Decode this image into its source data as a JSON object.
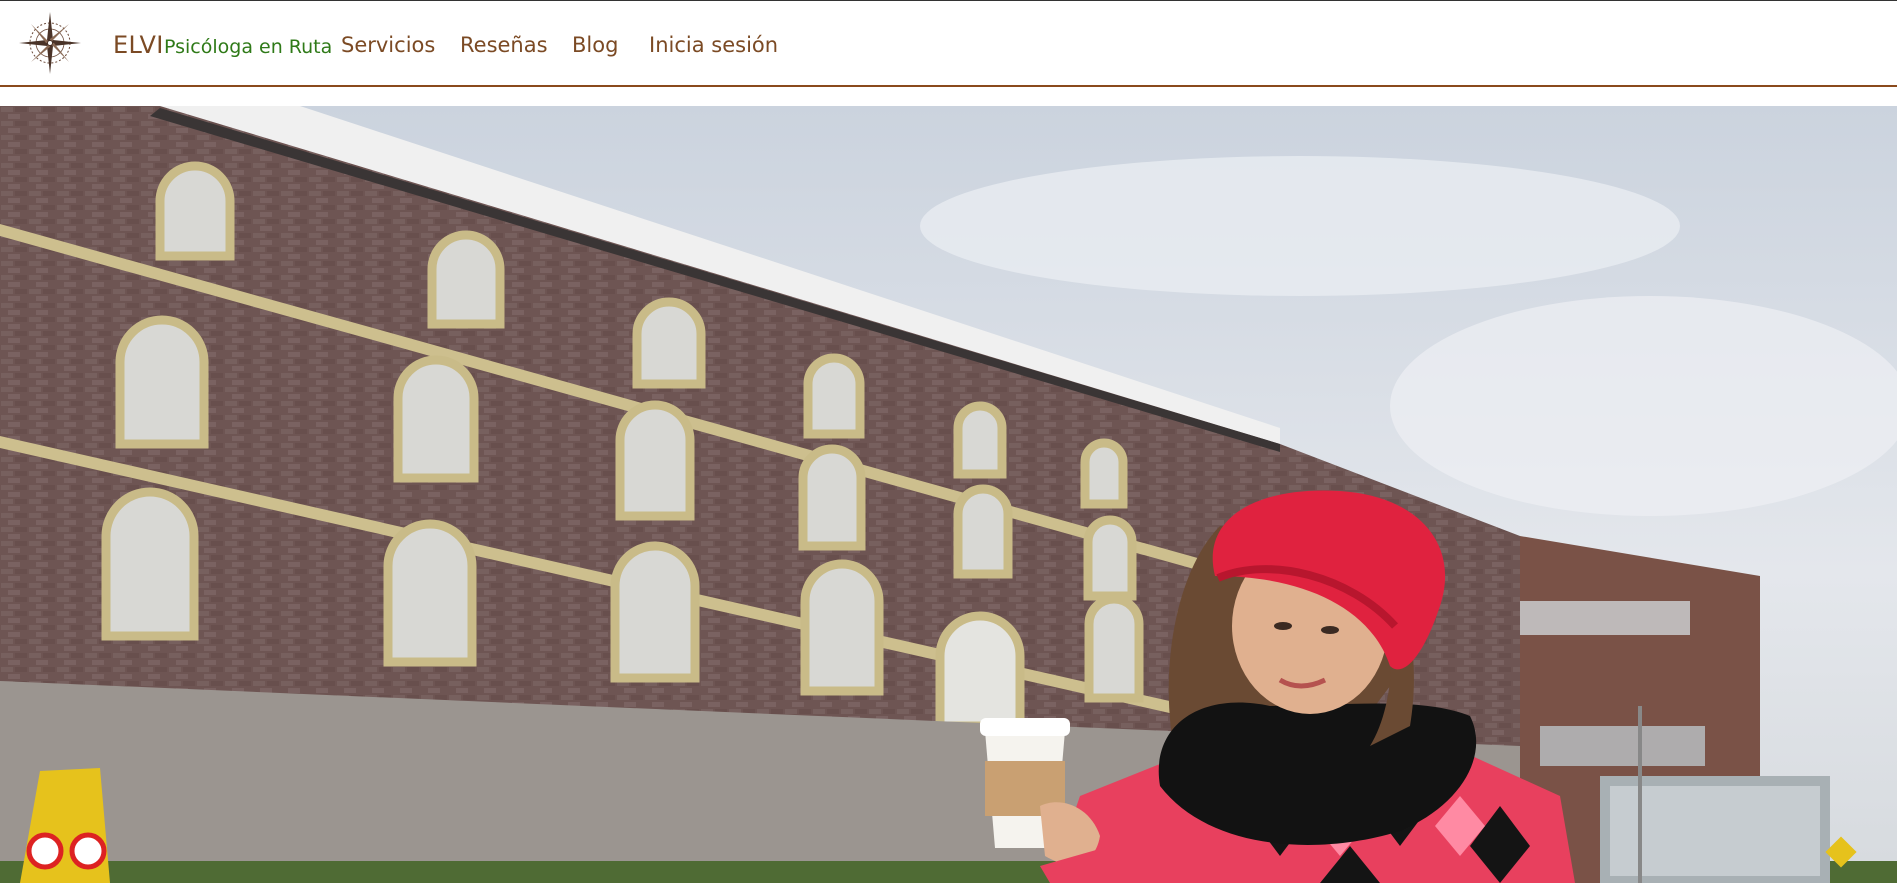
{
  "brand": {
    "name": "ELVI",
    "tagline": "Psicóloga en Ruta",
    "logo_icon": "compass-rose-icon"
  },
  "nav": {
    "items": [
      {
        "label": "Servicios"
      },
      {
        "label": "Reseñas"
      },
      {
        "label": "Blog"
      },
      {
        "label": "Inicia sesión"
      }
    ]
  },
  "colors": {
    "brand_brown": "#7b4a24",
    "tagline_green": "#2f7a18",
    "nav_border": "#8a4a1c"
  }
}
